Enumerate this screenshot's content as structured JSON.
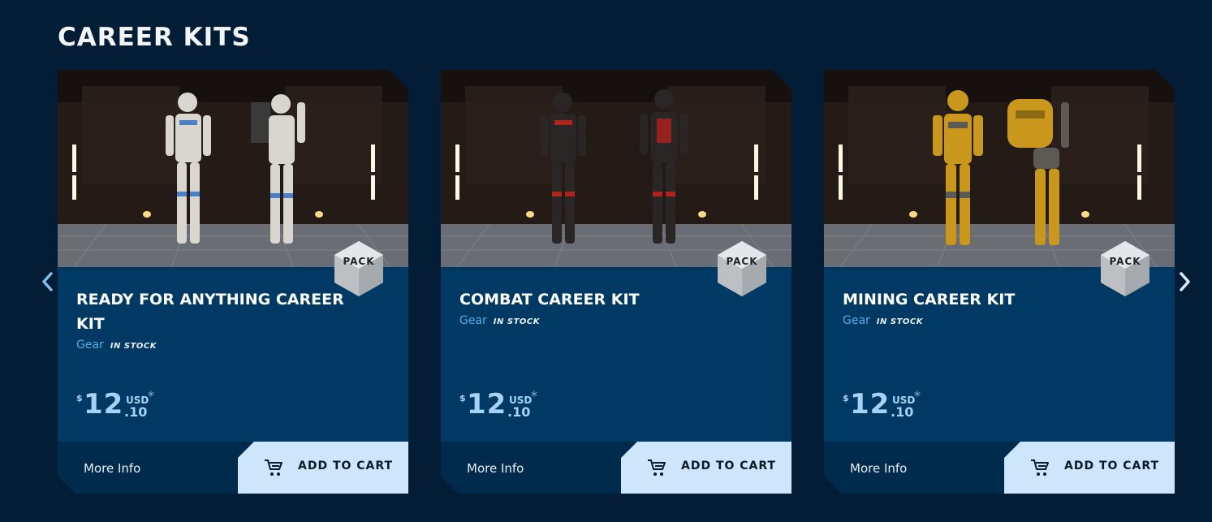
{
  "section": {
    "title": "CAREER KITS"
  },
  "carousel": {
    "prev_icon": "chevron-left-icon",
    "next_icon": "chevron-right-icon"
  },
  "colors": {
    "background": "#021d35",
    "card": "#003a64",
    "card_footer": "#012b4d",
    "accent_link": "#5aa9e6",
    "price": "#a6d3f5",
    "cart_button": "#cde6fb"
  },
  "cards": [
    {
      "title": "READY FOR ANYTHING CAREER KIT",
      "badge": "PACK",
      "category": "Gear",
      "stock": "IN STOCK",
      "price": {
        "symbol": "$",
        "whole": "12",
        "currency": "USD",
        "cents": ".10",
        "asterisk": "*"
      },
      "more_info": "More Info",
      "add_to_cart": "ADD TO CART",
      "armor_color": "#d8d6cf",
      "trim_color": "#4b7fc6"
    },
    {
      "title": "COMBAT CAREER KIT",
      "badge": "PACK",
      "category": "Gear",
      "stock": "IN STOCK",
      "price": {
        "symbol": "$",
        "whole": "12",
        "currency": "USD",
        "cents": ".10",
        "asterisk": "*"
      },
      "more_info": "More Info",
      "add_to_cart": "ADD TO CART",
      "armor_color": "#2a2626",
      "trim_color": "#b0221e"
    },
    {
      "title": "MINING CAREER KIT",
      "badge": "PACK",
      "category": "Gear",
      "stock": "IN STOCK",
      "price": {
        "symbol": "$",
        "whole": "12",
        "currency": "USD",
        "cents": ".10",
        "asterisk": "*"
      },
      "more_info": "More Info",
      "add_to_cart": "ADD TO CART",
      "armor_color": "#c9971c",
      "trim_color": "#5d5a55"
    }
  ]
}
